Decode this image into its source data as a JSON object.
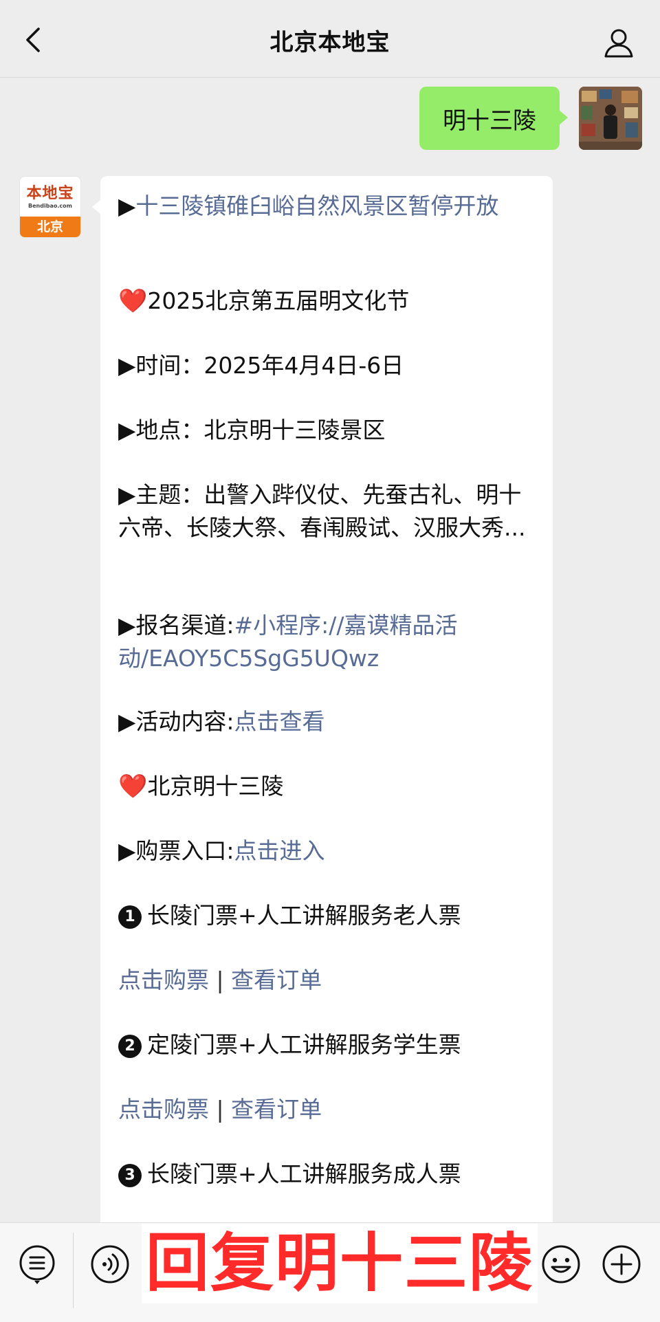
{
  "header": {
    "title": "北京本地宝"
  },
  "outgoing": {
    "text": "明十三陵"
  },
  "bot": {
    "logo_text": "本地宝",
    "logo_sub": "Bendibao.com",
    "logo_city": "北京"
  },
  "message": {
    "line1_prefix": "▶",
    "line1_link": "十三陵镇碓臼峪自然风景区暂停开放",
    "festival_heart": "❤️",
    "festival_title": "2025北京第五届明文化节",
    "time": "▶时间：2025年4月4日-6日",
    "place": "▶地点：北京明十三陵景区",
    "theme": "▶主题：出警入跸仪仗、先蚕古礼、明十六帝、长陵大祭、春闱殿试、汉服大秀...",
    "signup_label": "▶报名渠道:",
    "signup_link": "#小程序://嘉谟精品活动/EAOY5C5SgG5UQwz",
    "content_label": "▶活动内容:",
    "content_link": "点击查看",
    "section2_heart": "❤️",
    "section2_title": "北京明十三陵",
    "ticket_label": "▶购票入口:",
    "ticket_link": "点击进入",
    "items": [
      {
        "num": "1",
        "title": "长陵门票+人工讲解服务老人票",
        "buy": "点击购票",
        "sep": "|",
        "order": "查看订单"
      },
      {
        "num": "2",
        "title": "定陵门票+人工讲解服务学生票",
        "buy": "点击购票",
        "sep": "|",
        "order": "查看订单"
      },
      {
        "num": "3",
        "title": "长陵门票+人工讲解服务成人票"
      }
    ]
  },
  "overlay": {
    "text": "回复明十三陵"
  },
  "icons": {
    "back": "chevron-left-icon",
    "profile": "user-icon",
    "menu": "menu-list-icon",
    "voice": "voice-icon",
    "emoji": "emoji-icon",
    "plus": "plus-icon"
  }
}
